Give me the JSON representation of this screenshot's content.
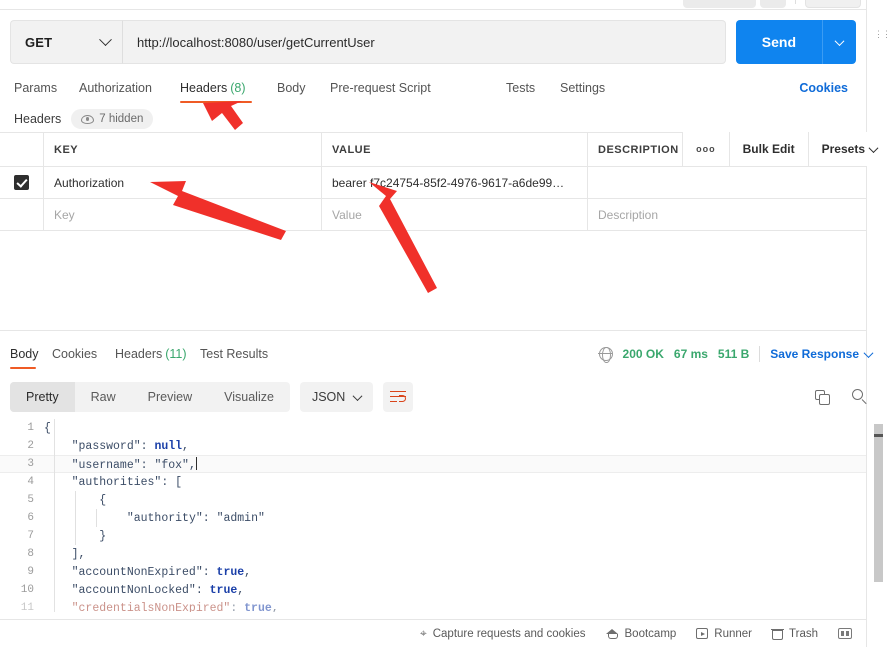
{
  "request": {
    "method": "GET",
    "url": "http://localhost:8080/user/getCurrentUser",
    "send_label": "Send",
    "tabs": [
      {
        "label": "Params",
        "count": "",
        "active": false
      },
      {
        "label": "Authorization",
        "count": "",
        "active": false
      },
      {
        "label": "Headers",
        "count": "(8)",
        "active": true
      },
      {
        "label": "Body",
        "count": "",
        "active": false
      },
      {
        "label": "Pre-request Script",
        "count": "",
        "active": false
      },
      {
        "label": "Tests",
        "count": "",
        "active": false
      },
      {
        "label": "Settings",
        "count": "",
        "active": false
      }
    ],
    "cookies_link": "Cookies"
  },
  "headers_section": {
    "title": "Headers",
    "hidden_badge": "7 hidden",
    "columns": [
      "KEY",
      "VALUE",
      "DESCRIPTION"
    ],
    "actions": {
      "more": "ooo",
      "bulk_edit": "Bulk Edit",
      "presets": "Presets"
    },
    "rows": [
      {
        "checked": true,
        "key": "Authorization",
        "value": "bearer f7c24754-85f2-4976-9617-a6de99…",
        "description": ""
      }
    ],
    "placeholders": {
      "key": "Key",
      "value": "Value",
      "description": "Description"
    }
  },
  "response": {
    "tabs": [
      {
        "label": "Body",
        "count": "",
        "active": true
      },
      {
        "label": "Cookies",
        "count": "",
        "active": false
      },
      {
        "label": "Headers",
        "count": "(11)",
        "active": false
      },
      {
        "label": "Test Results",
        "count": "",
        "active": false
      }
    ],
    "status": "200 OK",
    "time": "67 ms",
    "size": "511 B",
    "save_response": "Save Response",
    "view_modes": [
      {
        "label": "Pretty",
        "active": true
      },
      {
        "label": "Raw",
        "active": false
      },
      {
        "label": "Preview",
        "active": false
      },
      {
        "label": "Visualize",
        "active": false
      }
    ],
    "format": "JSON",
    "body_lines": [
      {
        "n": "1",
        "text": "{"
      },
      {
        "n": "2",
        "text": "    \"password\": null,"
      },
      {
        "n": "3",
        "text": "    \"username\": \"fox\","
      },
      {
        "n": "4",
        "text": "    \"authorities\": ["
      },
      {
        "n": "5",
        "text": "        {"
      },
      {
        "n": "6",
        "text": "            \"authority\": \"admin\""
      },
      {
        "n": "7",
        "text": "        }"
      },
      {
        "n": "8",
        "text": "    ],"
      },
      {
        "n": "9",
        "text": "    \"accountNonExpired\": true,"
      },
      {
        "n": "10",
        "text": "    \"accountNonLocked\": true,"
      },
      {
        "n": "11",
        "text": "    \"credentialsNonExpired\": true,"
      }
    ]
  },
  "status_bar": {
    "items": [
      {
        "label": "Capture requests and cookies",
        "icon": "capture-icon"
      },
      {
        "label": "Bootcamp",
        "icon": "bootcamp-icon"
      },
      {
        "label": "Runner",
        "icon": "runner-icon"
      },
      {
        "label": "Trash",
        "icon": "trash-icon"
      }
    ]
  },
  "colors": {
    "accent_orange": "#ef5b25",
    "send_blue": "#0f84ef",
    "link_blue": "#0f6bd8",
    "status_green": "#3aa76d",
    "annotation_red": "#f0302a"
  }
}
